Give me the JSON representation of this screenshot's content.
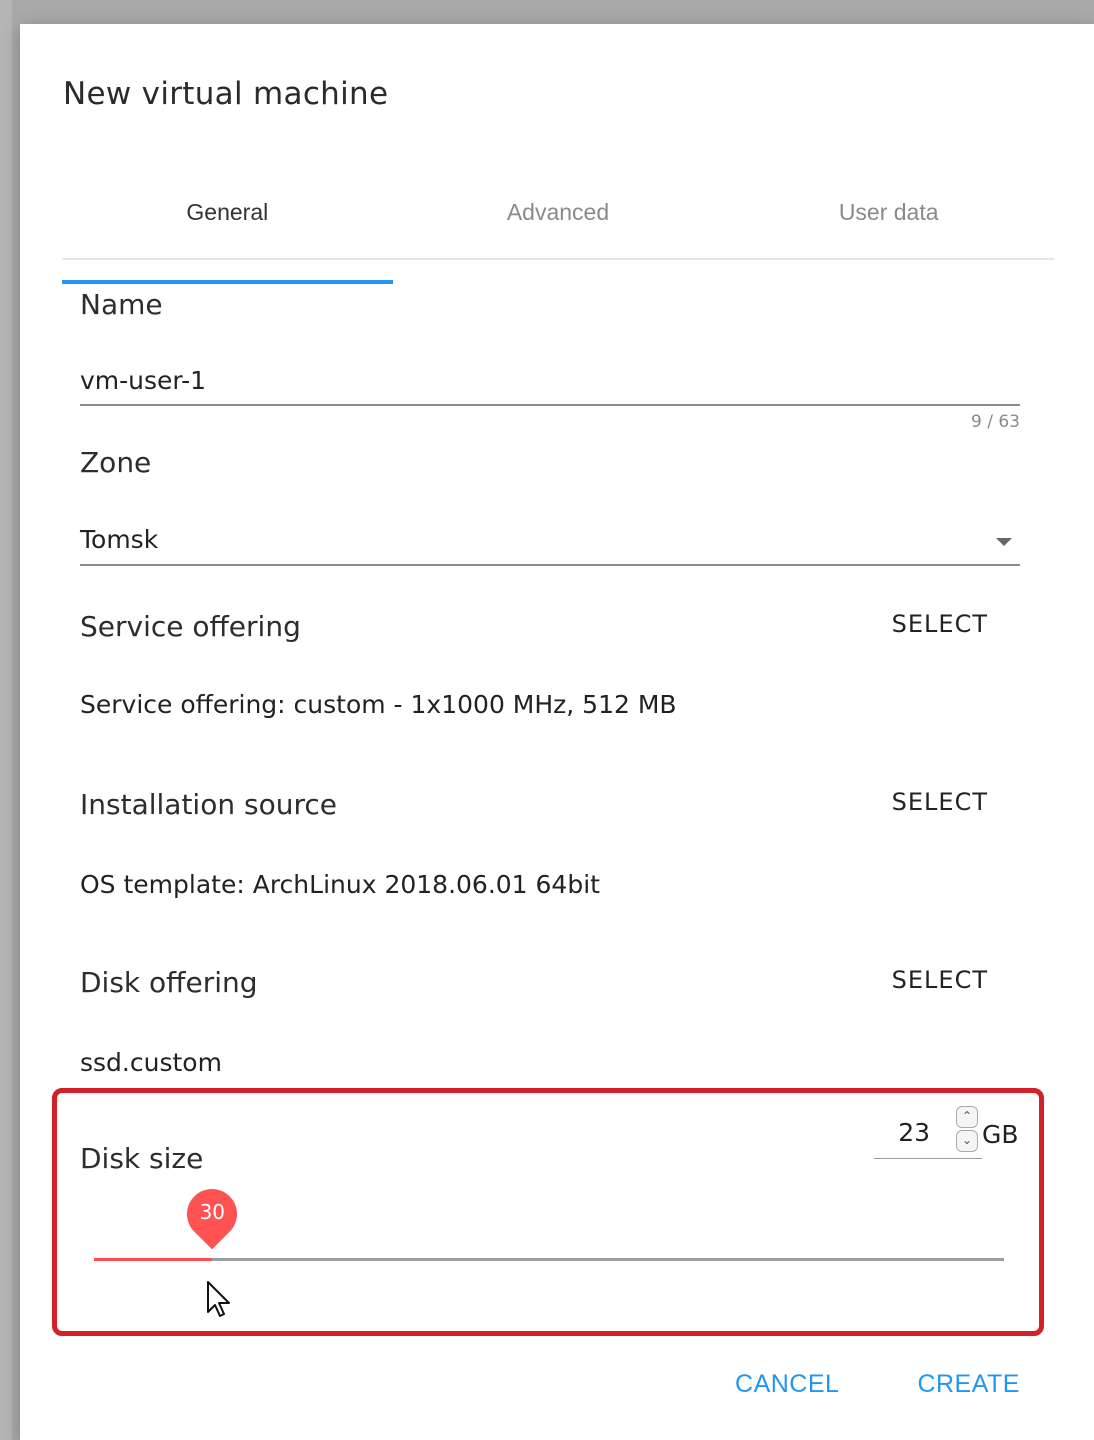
{
  "dialog": {
    "title": "New virtual machine",
    "tabs": [
      {
        "label": "General",
        "active": true
      },
      {
        "label": "Advanced",
        "active": false
      },
      {
        "label": "User data",
        "active": false
      }
    ]
  },
  "form": {
    "name": {
      "label": "Name",
      "value": "vm-user-1",
      "counter": "9 / 63"
    },
    "zone": {
      "label": "Zone",
      "value": "Tomsk"
    },
    "service_offering": {
      "title": "Service offering",
      "select_label": "SELECT",
      "value": "Service offering: custom - 1x1000 MHz, 512 MB"
    },
    "installation_source": {
      "title": "Installation source",
      "select_label": "SELECT",
      "value": "OS template: ArchLinux 2018.06.01 64bit"
    },
    "disk_offering": {
      "title": "Disk offering",
      "select_label": "SELECT",
      "value": "ssd.custom"
    },
    "disk_size": {
      "label": "Disk size",
      "input_value": "23",
      "unit": "GB",
      "slider_value": "30",
      "slider_fraction": 0.13
    }
  },
  "actions": {
    "cancel_label": "CANCEL",
    "create_label": "CREATE"
  },
  "colors": {
    "accent": "#2196f3",
    "slider": "#ff5252",
    "highlight": "#d42028"
  }
}
